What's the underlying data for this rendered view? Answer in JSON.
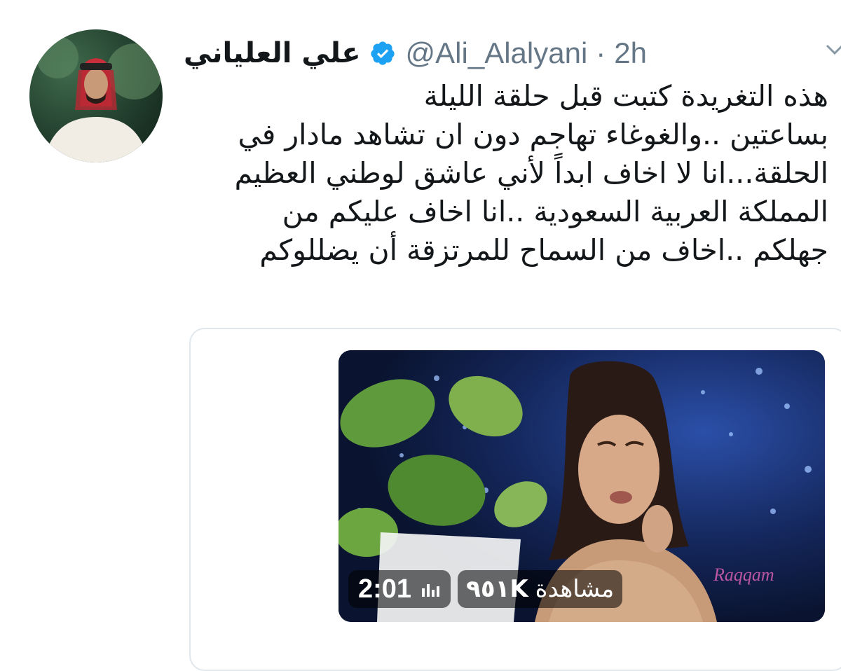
{
  "author": {
    "display_name": "علي العلياني",
    "handle": "@Ali_Alalyani",
    "separator": "·",
    "timestamp": "2h",
    "verified": true,
    "avatar_icon": "person-avatar-icon"
  },
  "tweet": {
    "lines": [
      "هذه التغريدة كتبت قبل حلقة الليلة",
      "بساعتين ..والغوغاء تهاجم دون ان تشاهد مادار في",
      "الحلقة...انا لا اخاف ابداً لأني عاشق لوطني العظيم",
      "المملكة العربية السعودية ..انا اخاف عليكم من",
      "جهلكم ..اخاف من السماح للمرتزقة أن يضللوكم"
    ]
  },
  "media": {
    "duration": "2:01",
    "views_count": "٩٥١K",
    "views_label": "مشاهدة",
    "watermark": "Raqqam"
  },
  "colors": {
    "text": "#14171a",
    "secondary": "#657786",
    "verified": "#1da1f2",
    "border": "#e1e8ed"
  }
}
